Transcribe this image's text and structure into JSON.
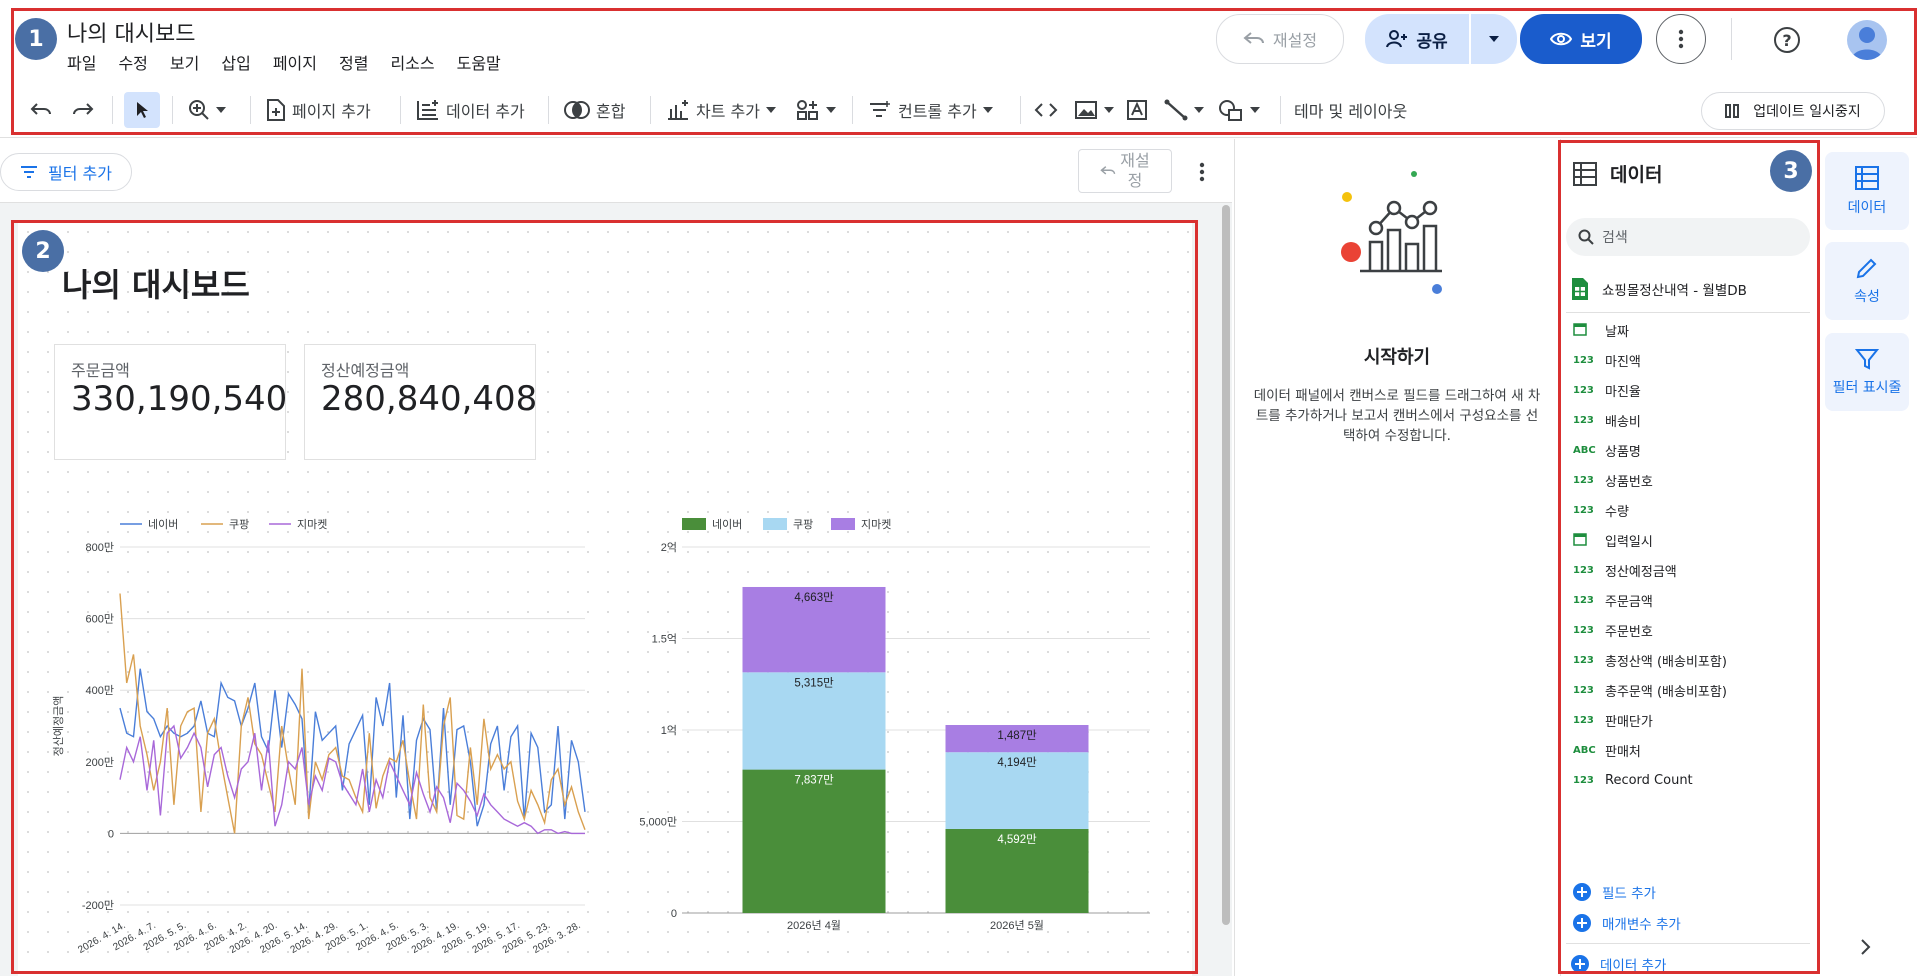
{
  "app": {
    "title": "나의 대시보드",
    "menu": [
      "파일",
      "수정",
      "보기",
      "삽입",
      "페이지",
      "정렬",
      "리소스",
      "도움말"
    ]
  },
  "header_buttons": {
    "reset": "재설정",
    "share": "공유",
    "view": "보기"
  },
  "toolbar": {
    "add_page": "페이지 추가",
    "add_data": "데이터 추가",
    "blend": "혼합",
    "add_chart": "차트 추가",
    "add_control": "컨트롤 추가",
    "theme_layout": "테마 및 레이아웃",
    "pause_updates": "업데이트 일시중지"
  },
  "canvas_bar": {
    "add_filter": "필터 추가",
    "reset": "재설정"
  },
  "report": {
    "title": "나의 대시보드",
    "scorecards": [
      {
        "label": "주문금액",
        "value": "330,190,540"
      },
      {
        "label": "정산예정금액",
        "value": "280,840,408"
      }
    ]
  },
  "chart_data": [
    {
      "type": "line",
      "title": "",
      "ylabel": "정산예정금액",
      "ylim": [
        -200,
        800
      ],
      "y_ticks": [
        "800만",
        "600만",
        "400만",
        "200만",
        "0",
        "-200만"
      ],
      "x_tick_labels": [
        "2026. 4. 14.",
        "2026. 4. 7.",
        "2026. 5. 5.",
        "2026. 4. 6.",
        "2026. 4. 2.",
        "2026. 4. 20.",
        "2026. 5. 14.",
        "2026. 4. 29.",
        "2026. 5. 1.",
        "2026. 4. 5.",
        "2026. 5. 3.",
        "2026. 4. 19.",
        "2026. 5. 19.",
        "2026. 5. 17.",
        "2026. 5. 23.",
        "2026. 3. 28."
      ],
      "legend_position": "top-left",
      "series": [
        {
          "name": "네이버",
          "color": "#4a7ed9",
          "values": [
            350,
            280,
            270,
            460,
            340,
            320,
            270,
            300,
            280,
            270,
            280,
            300,
            370,
            280,
            270,
            420,
            380,
            370,
            300,
            350,
            420,
            270,
            230,
            400,
            240,
            390,
            360,
            320,
            60,
            340,
            260,
            280,
            300,
            120,
            250,
            290,
            330,
            80,
            380,
            300,
            420,
            100,
            330,
            40,
            260,
            320,
            290,
            60,
            350,
            80,
            290,
            300,
            200,
            20,
            80,
            250,
            300,
            120,
            270,
            300,
            40,
            280,
            240,
            60,
            80,
            300,
            40,
            260,
            200,
            60
          ]
        },
        {
          "name": "쿠팡",
          "color": "#d9a050",
          "values": [
            670,
            420,
            500,
            300,
            220,
            120,
            200,
            350,
            80,
            300,
            340,
            350,
            60,
            280,
            320,
            200,
            100,
            0,
            300,
            380,
            250,
            220,
            140,
            60,
            300,
            180,
            80,
            460,
            40,
            200,
            150,
            220,
            240,
            160,
            150,
            100,
            60,
            280,
            70,
            160,
            210,
            200,
            260,
            140,
            40,
            360,
            100,
            60,
            300,
            380,
            50,
            40,
            240,
            80,
            320,
            180,
            220,
            180,
            200,
            90,
            40,
            120,
            80,
            30,
            150,
            180,
            80,
            130,
            60,
            10
          ]
        },
        {
          "name": "지마켓",
          "color": "#a868d9",
          "values": [
            150,
            240,
            200,
            270,
            120,
            260,
            50,
            280,
            300,
            210,
            240,
            280,
            240,
            130,
            220,
            240,
            160,
            100,
            180,
            200,
            280,
            120,
            260,
            20,
            80,
            200,
            180,
            240,
            80,
            160,
            120,
            210,
            200,
            140,
            110,
            80,
            180,
            60,
            150,
            100,
            200,
            160,
            120,
            80,
            170,
            110,
            60,
            130,
            100,
            30,
            140,
            120,
            90,
            50,
            110,
            80,
            60,
            40,
            30,
            20,
            30,
            20,
            0,
            10,
            10,
            0,
            5,
            0,
            0,
            0
          ]
        }
      ]
    },
    {
      "type": "bar",
      "stacked": true,
      "title": "",
      "categories": [
        "2026년 4월",
        "2026년 5월"
      ],
      "y_ticks": [
        "2억",
        "1.5억",
        "1억",
        "5,000만",
        "0"
      ],
      "ylim": [
        0,
        20000
      ],
      "legend_position": "top-left",
      "series": [
        {
          "name": "네이버",
          "color": "#4a8e3a",
          "values": [
            7837,
            4592
          ],
          "labels": [
            "7,837만",
            "4,592만"
          ]
        },
        {
          "name": "쿠팡",
          "color": "#a8d8f2",
          "values": [
            5315,
            4194
          ],
          "labels": [
            "5,315만",
            "4,194만"
          ]
        },
        {
          "name": "지마켓",
          "color": "#a87ee3",
          "values": [
            4663,
            1487
          ],
          "labels": [
            "4,663만",
            "1,487만"
          ]
        }
      ]
    }
  ],
  "start_panel": {
    "title": "시작하기",
    "body": "데이터 패널에서 캔버스로 필드를 드래그하여 새 차트를 추가하거나 보고서 캔버스에서 구성요소를 선택하여 수정합니다."
  },
  "data_panel": {
    "title": "데이터",
    "search_placeholder": "검색",
    "source": "쇼핑몰정산내역 - 월별DB",
    "fields": [
      {
        "type": "date",
        "name": "날짜"
      },
      {
        "type": "123",
        "name": "마진액"
      },
      {
        "type": "123",
        "name": "마진율"
      },
      {
        "type": "123",
        "name": "배송비"
      },
      {
        "type": "ABC",
        "name": "상품명"
      },
      {
        "type": "123",
        "name": "상품번호"
      },
      {
        "type": "123",
        "name": "수량"
      },
      {
        "type": "date",
        "name": "입력일시"
      },
      {
        "type": "123",
        "name": "정산예정금액"
      },
      {
        "type": "123",
        "name": "주문금액"
      },
      {
        "type": "123",
        "name": "주문번호"
      },
      {
        "type": "123",
        "name": "총정산액 (배송비포함)"
      },
      {
        "type": "123",
        "name": "총주문액 (배송비포함)"
      },
      {
        "type": "123",
        "name": "판매단가"
      },
      {
        "type": "ABC",
        "name": "판매처"
      },
      {
        "type": "123",
        "name": "Record Count"
      }
    ],
    "add_field": "필드 추가",
    "add_parameter": "매개변수 추가",
    "add_data": "데이터 추가"
  },
  "right_rail": {
    "data": "데이터",
    "properties": "속성",
    "filter_bar": "필터 표시줄"
  },
  "badges": [
    "1",
    "2",
    "3"
  ]
}
